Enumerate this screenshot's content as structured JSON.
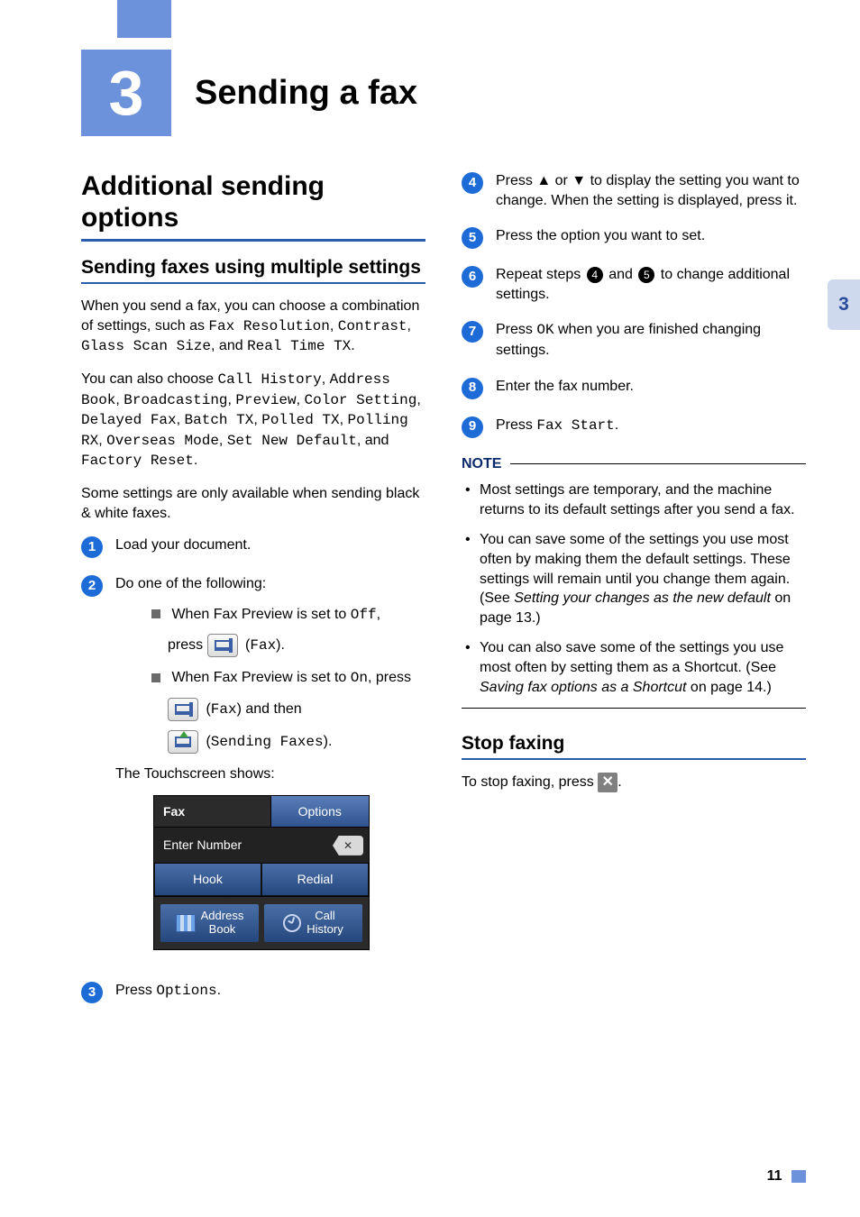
{
  "chapter": {
    "number": "3",
    "title": "Sending a fax",
    "side_tab": "3"
  },
  "left": {
    "h1": "Additional sending options",
    "h2": "Sending faxes using multiple settings",
    "p1a": "When you send a fax, you can choose a combination of settings, such as ",
    "p1_settings": [
      "Fax Resolution",
      "Contrast",
      "Glass Scan Size",
      "Real Time TX"
    ],
    "and": " and ",
    "comma": ", ",
    "period": ".",
    "p2a": "You can also choose ",
    "p2_settings": [
      "Call History",
      "Address Book",
      "Broadcasting",
      "Preview",
      "Color Setting",
      "Delayed Fax",
      "Batch TX",
      "Polled TX",
      "Polling RX",
      "Overseas Mode",
      "Set New Default"
    ],
    "p2_last": "Factory Reset",
    "p3": "Some settings are only available when sending black & white faxes.",
    "step1": "Load your document.",
    "step2": "Do one of the following:",
    "sub1a": "When Fax Preview is set to ",
    "off": "Off",
    "sub1b": "press ",
    "fax_label": "Fax",
    "paren_close_dot": ").",
    "sub2a": "When Fax Preview is set to ",
    "on": "On",
    "sub2b": ", press",
    "sub2c": ") and then",
    "sending_faxes": "Sending Faxes",
    "ts_intro": "The Touchscreen shows:",
    "ts": {
      "title": "Fax",
      "options": "Options",
      "enter": "Enter Number",
      "hook": "Hook",
      "redial": "Redial",
      "address_book": "Address\nBook",
      "call_history": "Call\nHistory"
    },
    "step3a": "Press ",
    "step3b": "Options"
  },
  "right": {
    "step4": "Press ▲ or ▼ to display the setting you want to change. When the setting is displayed, press it.",
    "step5": "Press the option you want to set.",
    "step6a": "Repeat steps ",
    "step6b": " and ",
    "step6c": " to change additional settings.",
    "badge4": "4",
    "badge5": "5",
    "step7a": "Press ",
    "step7_ok": "OK",
    "step7b": " when you are finished changing settings.",
    "step8": "Enter the fax number.",
    "step9a": "Press ",
    "step9b": "Fax Start",
    "note_label": "NOTE",
    "note1": "Most settings are temporary, and the machine returns to its default settings after you send a fax.",
    "note2a": "You can save some of the settings you use most often by making them the default settings. These settings will remain until you change them again. (See ",
    "note2_link": "Setting your changes as the new default",
    "note2b": " on page 13.)",
    "note3a": "You can also save some of the settings you use most often by setting them as a Shortcut. (See ",
    "note3_link": "Saving fax options as a Shortcut",
    "note3b": " on page 14.)",
    "h2_stop": "Stop faxing",
    "stop_a": "To stop faxing, press ",
    "stop_b": "."
  },
  "page_number": "11"
}
